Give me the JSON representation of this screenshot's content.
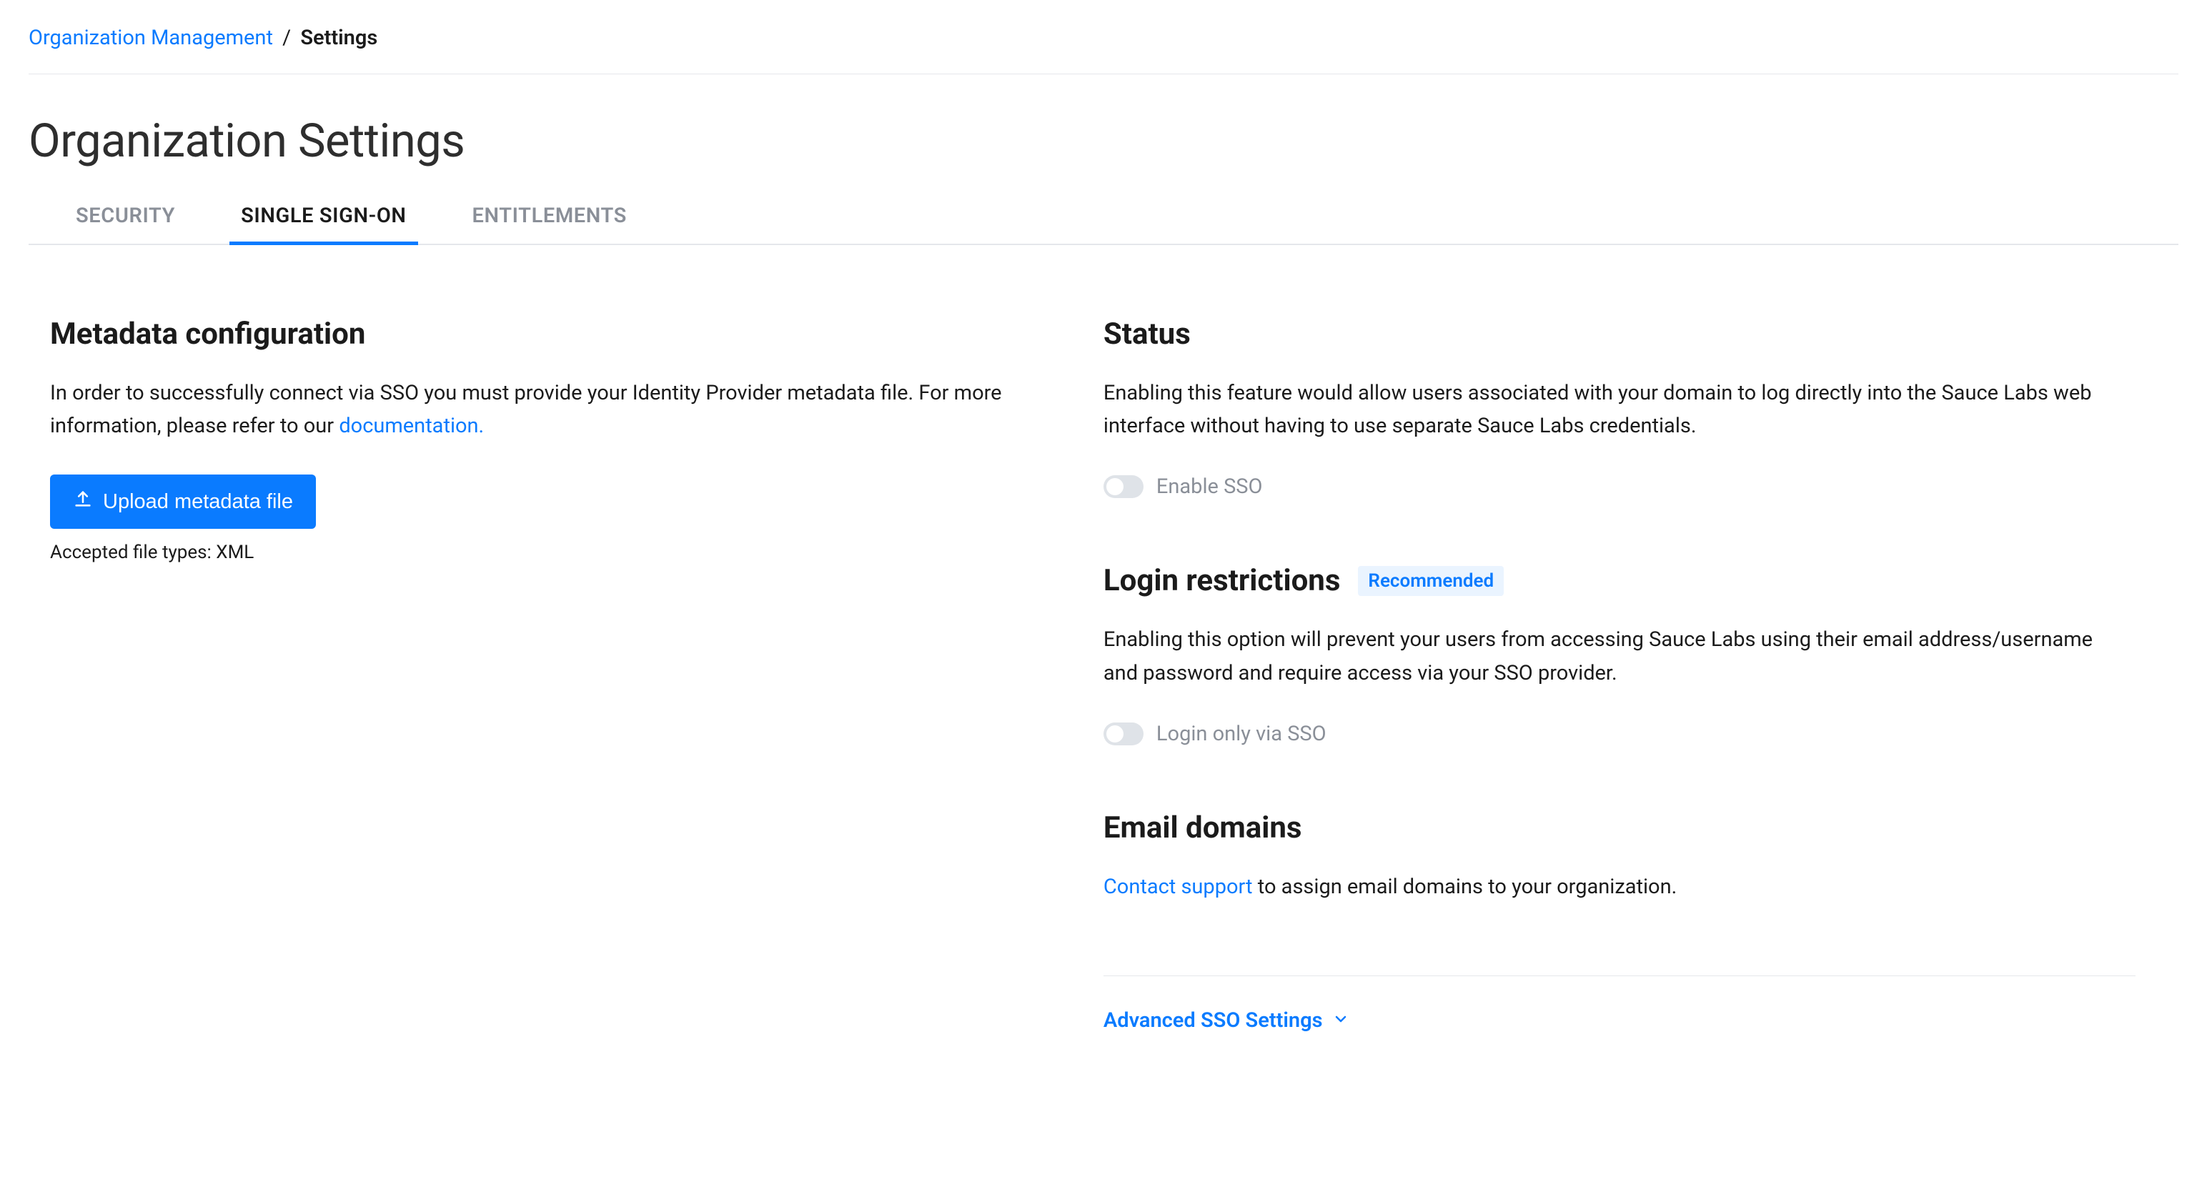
{
  "breadcrumb": {
    "parent": "Organization Management",
    "separator": "/",
    "current": "Settings"
  },
  "page_title": "Organization Settings",
  "tabs": {
    "security": "SECURITY",
    "sso": "SINGLE SIGN-ON",
    "entitlements": "ENTITLEMENTS"
  },
  "left": {
    "metadata": {
      "title": "Metadata configuration",
      "desc_pre": "In order to successfully connect via SSO you must provide your Identity Provider metadata file. For more information, please refer to our ",
      "desc_link": "documentation.",
      "upload_label": "Upload metadata file",
      "file_note": "Accepted file types: XML"
    }
  },
  "right": {
    "status": {
      "title": "Status",
      "desc": "Enabling this feature would allow users associated with your domain to log directly into the Sauce Labs web interface without having to use separate Sauce Labs credentials.",
      "toggle_label": "Enable SSO"
    },
    "login": {
      "title": "Login restrictions",
      "badge": "Recommended",
      "desc": "Enabling this option will prevent your users from accessing Sauce Labs using their email address/username and password and require access via your SSO provider.",
      "toggle_label": "Login only via SSO"
    },
    "email": {
      "title": "Email domains",
      "link": "Contact support",
      "desc_post": " to assign email domains to your organization."
    },
    "advanced_link": "Advanced SSO Settings"
  }
}
